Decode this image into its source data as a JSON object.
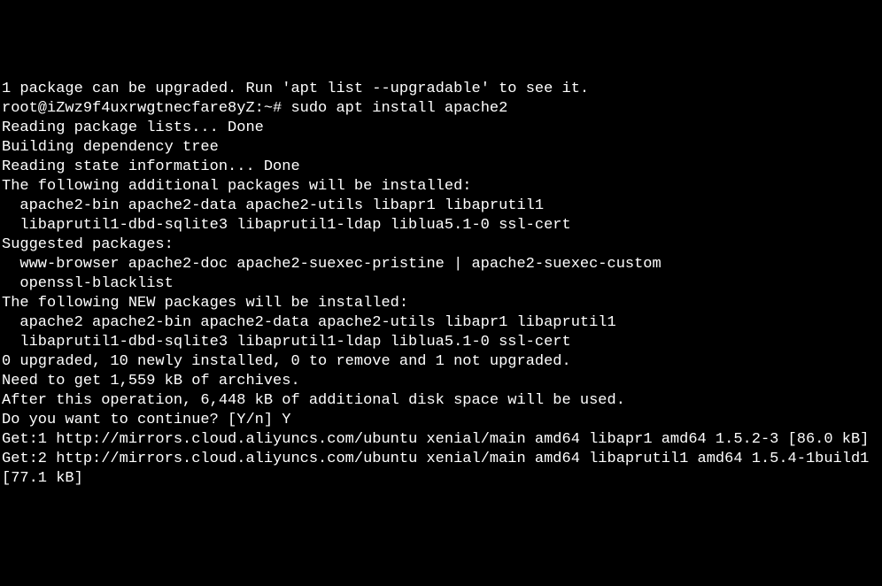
{
  "terminal": {
    "line1": "1 package can be upgraded. Run 'apt list --upgradable' to see it.",
    "prompt": "root@iZwz9f4uxrwgtnecfare8yZ:~# ",
    "command": "sudo apt install apache2",
    "line3": "Reading package lists... Done",
    "line4": "Building dependency tree",
    "line5": "Reading state information... Done",
    "line6": "The following additional packages will be installed:",
    "line7": "apache2-bin apache2-data apache2-utils libapr1 libaprutil1",
    "line8": "libaprutil1-dbd-sqlite3 libaprutil1-ldap liblua5.1-0 ssl-cert",
    "line9": "Suggested packages:",
    "line10": "www-browser apache2-doc apache2-suexec-pristine | apache2-suexec-custom",
    "line11": "openssl-blacklist",
    "line12": "The following NEW packages will be installed:",
    "line13": "apache2 apache2-bin apache2-data apache2-utils libapr1 libaprutil1",
    "line14": "libaprutil1-dbd-sqlite3 libaprutil1-ldap liblua5.1-0 ssl-cert",
    "line15": "0 upgraded, 10 newly installed, 0 to remove and 1 not upgraded.",
    "line16": "Need to get 1,559 kB of archives.",
    "line17": "After this operation, 6,448 kB of additional disk space will be used.",
    "confirm_prompt": "Do you want to continue? [Y/n] ",
    "confirm_answer": "Y",
    "line19": "Get:1 http://mirrors.cloud.aliyuncs.com/ubuntu xenial/main amd64 libapr1 amd64 1.5.2-3 [86.0 kB]",
    "line20": "Get:2 http://mirrors.cloud.aliyuncs.com/ubuntu xenial/main amd64 libaprutil1 amd64 1.5.4-1build1 [77.1 kB]"
  }
}
